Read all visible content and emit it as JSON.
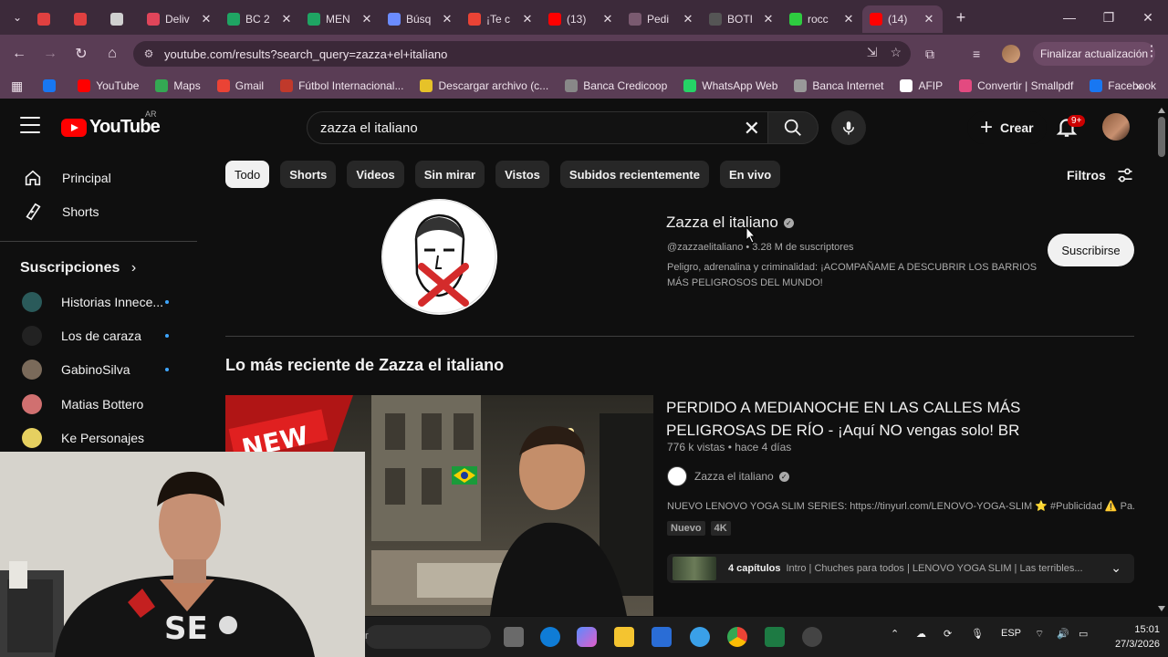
{
  "browser": {
    "tabs": [
      {
        "label": "",
        "fav": "#e04040",
        "close": false
      },
      {
        "label": "",
        "fav": "#e04040",
        "close": false
      },
      {
        "label": "",
        "fav": "#d0d0d0",
        "close": false
      },
      {
        "label": "Deliv",
        "fav": "#e0455a",
        "close": true
      },
      {
        "label": "BC 2",
        "fav": "#1fa463",
        "close": true
      },
      {
        "label": "MEN",
        "fav": "#1fa463",
        "close": true
      },
      {
        "label": "Búsq",
        "fav": "#6b8cff",
        "close": true
      },
      {
        "label": "¡Te c",
        "fav": "#ea4335",
        "close": true
      },
      {
        "label": "(13) ",
        "fav": "#ff0000",
        "close": true
      },
      {
        "label": "Pedi",
        "fav": "#7a5a70",
        "close": true
      },
      {
        "label": "BOTI",
        "fav": "#555555",
        "close": true
      },
      {
        "label": "rocc",
        "fav": "#2ecc40",
        "close": true
      },
      {
        "label": "(14) ",
        "fav": "#ff0000",
        "close": true,
        "active": true
      }
    ],
    "url": "youtube.com/results?search_query=zazza+el+italiano",
    "update_label": "Finalizar actualización",
    "bookmarks": [
      {
        "label": "",
        "color": "#1877f2"
      },
      {
        "label": "YouTube",
        "color": "#ff0000"
      },
      {
        "label": "Maps",
        "color": "#34a853"
      },
      {
        "label": "Gmail",
        "color": "#ea4335"
      },
      {
        "label": "Fútbol Internacional...",
        "color": "#c0392b"
      },
      {
        "label": "Descargar archivo (c...",
        "color": "#e6c229"
      },
      {
        "label": "Banca Credicoop",
        "color": "#888888"
      },
      {
        "label": "WhatsApp Web",
        "color": "#25d366"
      },
      {
        "label": "Banca Internet",
        "color": "#999999"
      },
      {
        "label": "AFIP",
        "color": "#ffffff"
      },
      {
        "label": "Convertir | Smallpdf",
        "color": "#e34a80"
      },
      {
        "label": "Facebook",
        "color": "#1877f2"
      }
    ]
  },
  "youtube": {
    "logo_word": "YouTube",
    "country": "AR",
    "search_value": "zazza el italiano",
    "create_label": "Crear",
    "notif_badge": "9+",
    "sidebar": {
      "items": [
        {
          "label": "Principal",
          "icon": "home-icon"
        },
        {
          "label": "Shorts",
          "icon": "shorts-icon"
        }
      ],
      "subs_title": "Suscripciones",
      "subs": [
        {
          "label": "Historias Innece...",
          "color": "#2a5a5a",
          "dot": true
        },
        {
          "label": "Los de caraza",
          "color": "#222222",
          "dot": true
        },
        {
          "label": "GabinoSilva",
          "color": "#7a6a5a",
          "dot": true
        },
        {
          "label": "Matias Bottero",
          "color": "#d07070",
          "dot": false
        },
        {
          "label": "Ke Personajes",
          "color": "#e6d060",
          "dot": false
        }
      ]
    },
    "chips": [
      "Todo",
      "Shorts",
      "Videos",
      "Sin mirar",
      "Vistos",
      "Subidos recientemente",
      "En vivo"
    ],
    "filters_label": "Filtros",
    "channel": {
      "name": "Zazza el italiano",
      "meta": "@zazzaelitaliano • 3.28 M de suscriptores",
      "desc": "Peligro, adrenalina y criminalidad: ¡ACOMPAÑAME A DESCUBRIR LOS BARRIOS MÁS PELIGROSOS DEL MUNDO!",
      "subscribe": "Suscribirse"
    },
    "section_title": "Lo más reciente de Zazza el italiano",
    "video": {
      "thumb_text": "NEW",
      "title": "PERDIDO A MEDIANOCHE EN LAS CALLES MÁS PELIGROSAS DE RÍO - ¡Aquí NO vengas solo! BR",
      "meta": "776 k vistas • hace 4 días",
      "channel": "Zazza el italiano",
      "desc": "NUEVO LENOVO YOGA SLIM SERIES: https://tinyurl.com/LENOVO-YOGA-SLIM ⭐ #Publicidad ⚠️ Pa...",
      "badges": [
        "Nuevo",
        "4K"
      ],
      "chapters_count": "4 capítulos",
      "chapters_text": "Intro | Chuches para todos | LENOVO YOGA SLIM | Las terribles..."
    }
  },
  "taskbar": {
    "lang": "ESP",
    "time": "15:01",
    "date": "27/3/2026"
  }
}
